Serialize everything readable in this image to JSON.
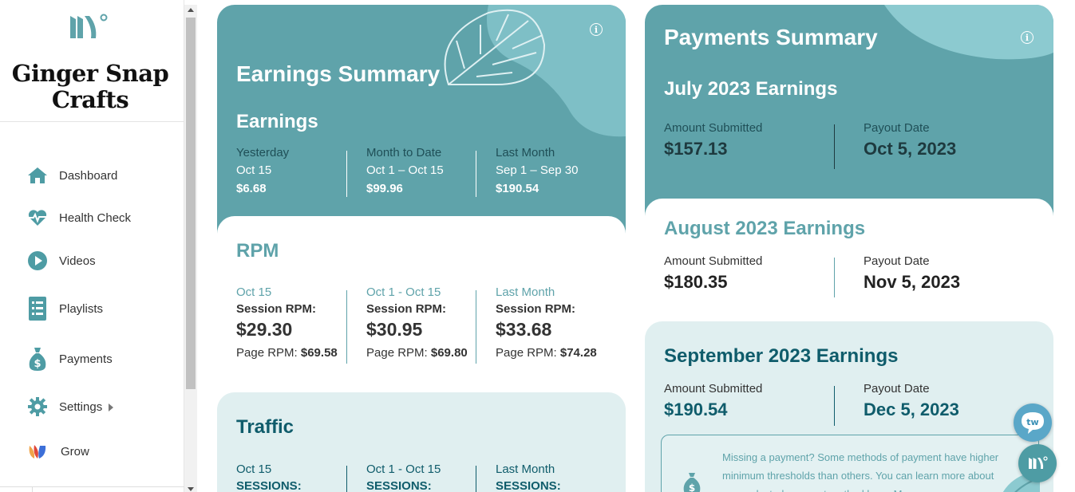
{
  "brand": {
    "name_line1": "Ginger Snap",
    "name_line2": "Crafts",
    "logo_icon": "mediavine-logo-icon"
  },
  "sidebar": {
    "items": [
      {
        "label": "Dashboard",
        "icon": "home-icon"
      },
      {
        "label": "Health Check",
        "icon": "heartbeat-icon"
      },
      {
        "label": "Videos",
        "icon": "play-circle-icon"
      },
      {
        "label": "Playlists",
        "icon": "list-icon"
      },
      {
        "label": "Payments",
        "icon": "money-bag-icon"
      },
      {
        "label": "Settings",
        "icon": "gear-icon"
      },
      {
        "label": "Grow",
        "icon": "grow-logo-icon"
      }
    ]
  },
  "earnings": {
    "title": "Earnings Summary",
    "subtitle": "Earnings",
    "columns": [
      {
        "label": "Yesterday",
        "range": "Oct 15",
        "value": "$6.68"
      },
      {
        "label": "Month to Date",
        "range": "Oct 1 – Oct 15",
        "value": "$99.96"
      },
      {
        "label": "Last Month",
        "range": "Sep 1 – Sep 30",
        "value": "$190.54"
      }
    ]
  },
  "rpm": {
    "title": "RPM",
    "columns": [
      {
        "period": "Oct 15",
        "session_label": "Session RPM:",
        "session_value": "$29.30",
        "page_label": "Page RPM:",
        "page_value": "$69.58"
      },
      {
        "period": "Oct 1 - Oct 15",
        "session_label": "Session RPM:",
        "session_value": "$30.95",
        "page_label": "Page RPM:",
        "page_value": "$69.80"
      },
      {
        "period": "Last Month",
        "session_label": "Session RPM:",
        "session_value": "$33.68",
        "page_label": "Page RPM:",
        "page_value": "$74.28"
      }
    ]
  },
  "traffic": {
    "title": "Traffic",
    "columns": [
      {
        "period": "Oct 15",
        "label": "SESSIONS:"
      },
      {
        "period": "Oct 1 - Oct 15",
        "label": "SESSIONS:"
      },
      {
        "period": "Last Month",
        "label": "SESSIONS:"
      }
    ]
  },
  "payments": {
    "title": "Payments Summary",
    "months": [
      {
        "title": "July 2023 Earnings",
        "submitted_label": "Amount Submitted",
        "submitted_value": "$157.13",
        "payout_label": "Payout Date",
        "payout_value": "Oct 5, 2023"
      },
      {
        "title": "August 2023 Earnings",
        "submitted_label": "Amount Submitted",
        "submitted_value": "$180.35",
        "payout_label": "Payout Date",
        "payout_value": "Nov 5, 2023"
      },
      {
        "title": "September 2023 Earnings",
        "submitted_label": "Amount Submitted",
        "submitted_value": "$190.54",
        "payout_label": "Payout Date",
        "payout_value": "Dec 5, 2023"
      }
    ],
    "notice": "Missing a payment? Some methods of payment have higher minimum thresholds than others. You can learn more about your selected payment method here. M"
  },
  "colors": {
    "teal": "#5fa3aa",
    "dark_teal": "#0f5c6b",
    "pale": "#e0eff0"
  }
}
